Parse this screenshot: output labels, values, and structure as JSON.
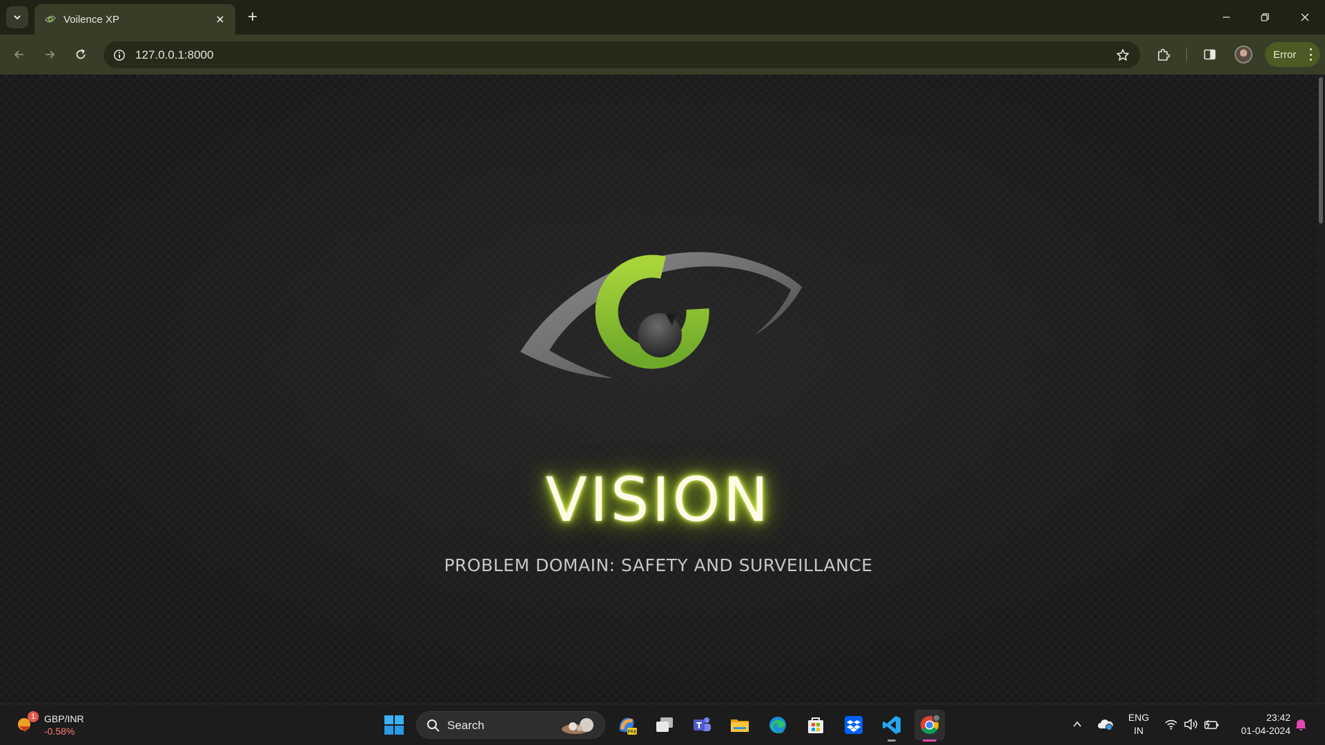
{
  "browser": {
    "tab_title": "Voilence XP",
    "url": "127.0.0.1:8000",
    "profile_status": "Error"
  },
  "page": {
    "title": "VISION",
    "subtitle": "PROBLEM DOMAIN: SAFETY AND SURVEILLANCE",
    "logo_icon": "eye-logo-icon",
    "accent_color": "#8bc53f",
    "glow_color": "#d4f03a"
  },
  "taskbar": {
    "widget": {
      "badge": "1",
      "pair": "GBP/INR",
      "change": "-0.58%"
    },
    "search_label": "Search",
    "apps": [
      "windows-start",
      "copilot",
      "task-view",
      "teams",
      "file-explorer",
      "edge",
      "microsoft-store",
      "dropbox",
      "vscode",
      "chrome"
    ],
    "language": {
      "line1": "ENG",
      "line2": "IN"
    },
    "time": "23:42",
    "date": "01-04-2024"
  }
}
